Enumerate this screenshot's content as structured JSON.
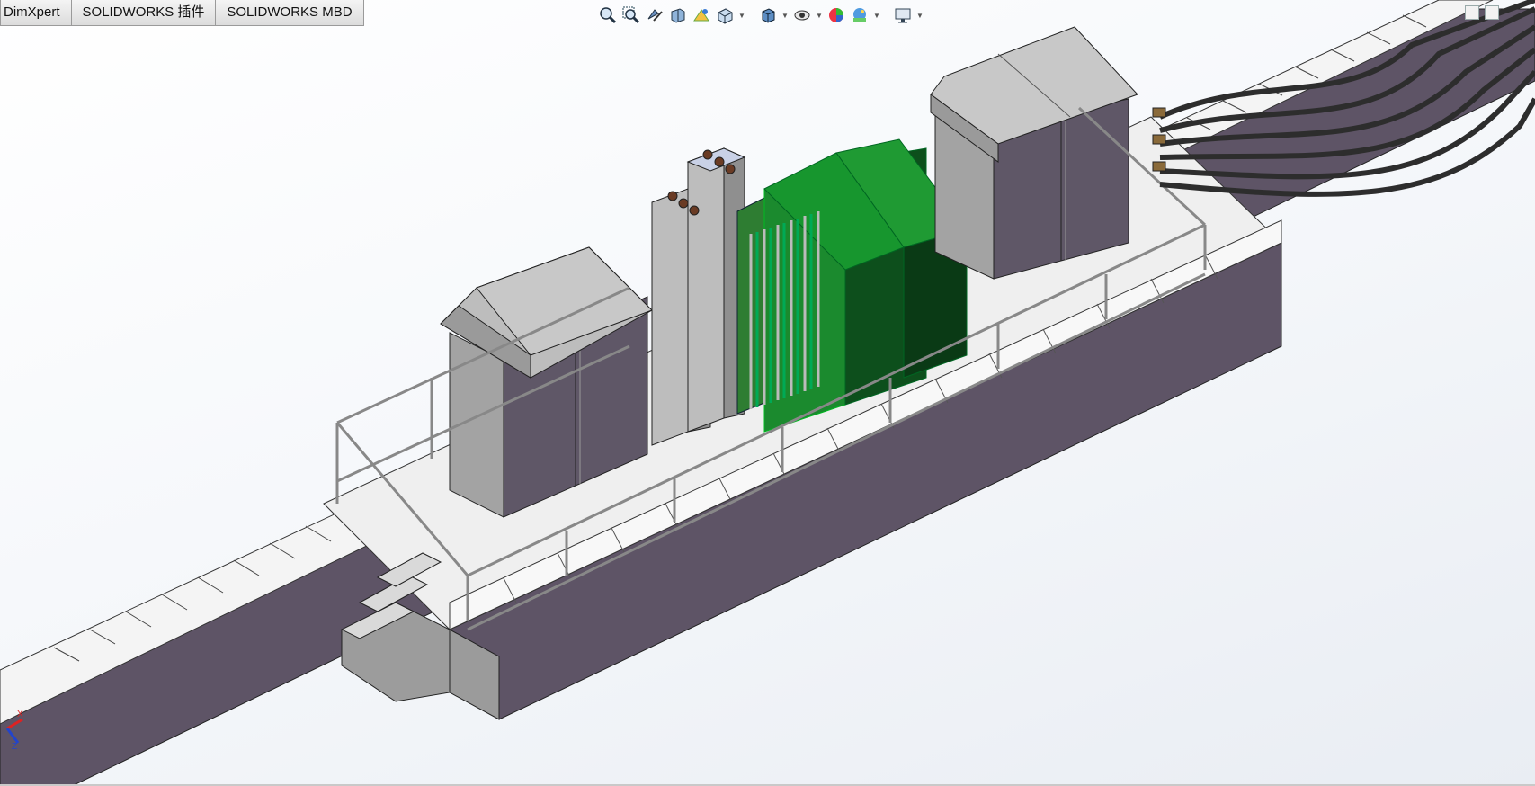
{
  "tabs": [
    "DimXpert",
    "SOLIDWORKS 插件",
    "SOLIDWORKS MBD"
  ],
  "heads_up_toolbar": {
    "tools": [
      "zoom-to-fit-icon",
      "zoom-to-area-icon",
      "previous-view-icon",
      "section-view-icon",
      "dynamic-annotation-icon",
      "view-orientation-icon",
      "display-style-icon",
      "hide-show-items-icon",
      "edit-appearance-icon",
      "apply-scene-icon",
      "view-settings-icon"
    ]
  },
  "triad": {
    "x_label": "X",
    "z_label": "Z"
  },
  "colors": {
    "accent": "#1b8a2e",
    "cabinet": "#bdbdbd",
    "wall": "#5a5060",
    "platform": "#efefef"
  }
}
